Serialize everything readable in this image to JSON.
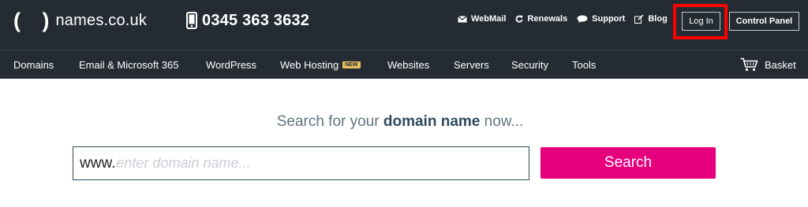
{
  "header": {
    "logo": {
      "brackets": "( )",
      "text": "names.co.uk"
    },
    "phone": "0345 363 3632",
    "links": [
      {
        "label": "WebMail",
        "icon": "envelope-icon"
      },
      {
        "label": "Renewals",
        "icon": "refresh-icon"
      },
      {
        "label": "Support",
        "icon": "chat-icon"
      },
      {
        "label": "Blog",
        "icon": "pencil-icon"
      }
    ],
    "login_label": "Log In",
    "control_panel_label": "Control Panel"
  },
  "nav": {
    "items": [
      {
        "label": "Domains"
      },
      {
        "label": "Email & Microsoft 365"
      },
      {
        "label": "WordPress"
      },
      {
        "label": "Web Hosting",
        "badge": "NEW"
      },
      {
        "label": "Websites"
      },
      {
        "label": "Servers"
      },
      {
        "label": "Security"
      },
      {
        "label": "Tools"
      }
    ],
    "basket_label": "Basket"
  },
  "search": {
    "heading_pre": "Search for your ",
    "heading_bold": "domain name",
    "heading_post": " now...",
    "prefix": "www.",
    "placeholder": "enter domain name...",
    "value": "",
    "button_label": "Search"
  },
  "colors": {
    "header_bg": "#252b33",
    "accent": "#e6007e",
    "highlight": "#ff0000",
    "badge": "#e8c063"
  }
}
